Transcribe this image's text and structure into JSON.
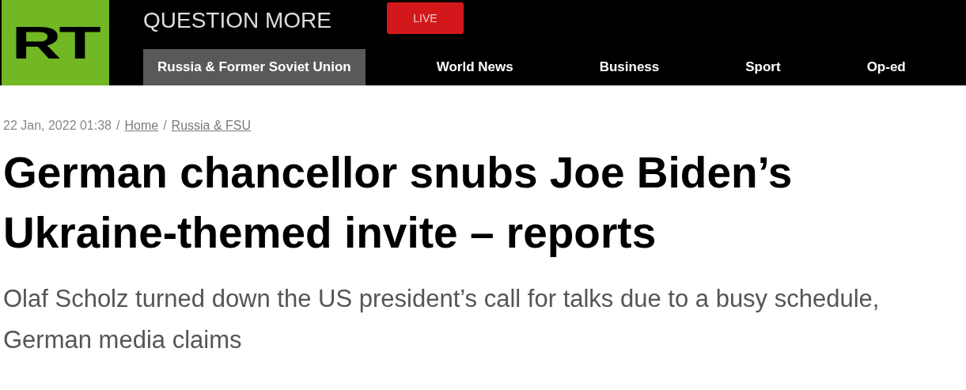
{
  "header": {
    "logo": "RT",
    "tagline": "QUESTION MORE",
    "live_button": "LIVE"
  },
  "nav": [
    {
      "label": "Russia & Former Soviet Union",
      "selected": true
    },
    {
      "label": "World News",
      "selected": false
    },
    {
      "label": "Business",
      "selected": false
    },
    {
      "label": "Sport",
      "selected": false
    },
    {
      "label": "Op-ed",
      "selected": false
    }
  ],
  "breadcrumb": [
    {
      "kind": "date",
      "text": "22 Jan, 2022 01:38"
    },
    {
      "kind": "separator",
      "text": "/"
    },
    {
      "kind": "link",
      "text": "Home"
    },
    {
      "kind": "separator",
      "text": "/"
    },
    {
      "kind": "link",
      "text": "Russia & FSU"
    }
  ],
  "article": {
    "headline": "German chancellor snubs Joe Biden’s Ukraine-themed invite – reports",
    "summary": "Olaf Scholz turned down the US president’s call for talks due to a busy schedule, German media claims"
  }
}
